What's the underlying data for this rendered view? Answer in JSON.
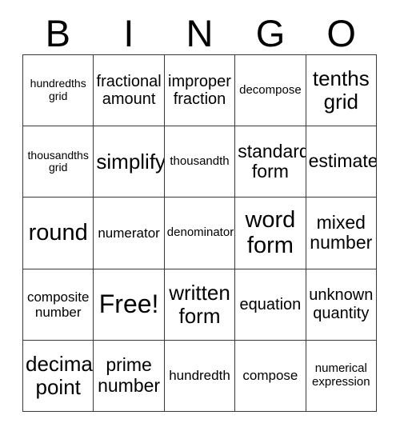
{
  "card": {
    "title": "BINGO",
    "header_letters": [
      "B",
      "I",
      "N",
      "G",
      "O"
    ],
    "columns": 5,
    "rows": 5,
    "free_space_label": "Free!",
    "free_space_position": {
      "row": 4,
      "column": 2
    },
    "colors": {
      "background": "#ffffff",
      "grid_line": "#3a3a3a",
      "text": "#000000"
    },
    "cells": [
      {
        "id": "r1c1",
        "text": "hundredths grid",
        "size": "xs"
      },
      {
        "id": "r1c2",
        "text": "fractional amount",
        "size": "lg"
      },
      {
        "id": "r1c3",
        "text": "improper fraction",
        "size": "lg"
      },
      {
        "id": "r1c4",
        "text": "decompose",
        "size": "sm"
      },
      {
        "id": "r1c5",
        "text": "tenths grid",
        "size": "2xl"
      },
      {
        "id": "r2c1",
        "text": "thousandths grid",
        "size": "xs"
      },
      {
        "id": "r2c2",
        "text": "simplify",
        "size": "2xl"
      },
      {
        "id": "r2c3",
        "text": "thousandth",
        "size": "sm"
      },
      {
        "id": "r2c4",
        "text": "standard form",
        "size": "xl"
      },
      {
        "id": "r2c5",
        "text": "estimate",
        "size": "xl"
      },
      {
        "id": "r3c1",
        "text": "round",
        "size": "3xl"
      },
      {
        "id": "r3c2",
        "text": "numerator",
        "size": "md"
      },
      {
        "id": "r3c3",
        "text": "denominator",
        "size": "sm"
      },
      {
        "id": "r3c4",
        "text": "word form",
        "size": "3xl"
      },
      {
        "id": "r3c5",
        "text": "mixed number",
        "size": "xl"
      },
      {
        "id": "r4c1",
        "text": "composite number",
        "size": "md"
      },
      {
        "id": "r4c2",
        "text": "Free!",
        "size": "4xl"
      },
      {
        "id": "r4c3",
        "text": "written form",
        "size": "2xl"
      },
      {
        "id": "r4c4",
        "text": "equation",
        "size": "lg"
      },
      {
        "id": "r4c5",
        "text": "unknown quantity",
        "size": "lg"
      },
      {
        "id": "r5c1",
        "text": "decimal point",
        "size": "2xl"
      },
      {
        "id": "r5c2",
        "text": "prime number",
        "size": "xl"
      },
      {
        "id": "r5c3",
        "text": "hundredth",
        "size": "md"
      },
      {
        "id": "r5c4",
        "text": "compose",
        "size": "md"
      },
      {
        "id": "r5c5",
        "text": "numerical expression",
        "size": "sm"
      }
    ]
  }
}
